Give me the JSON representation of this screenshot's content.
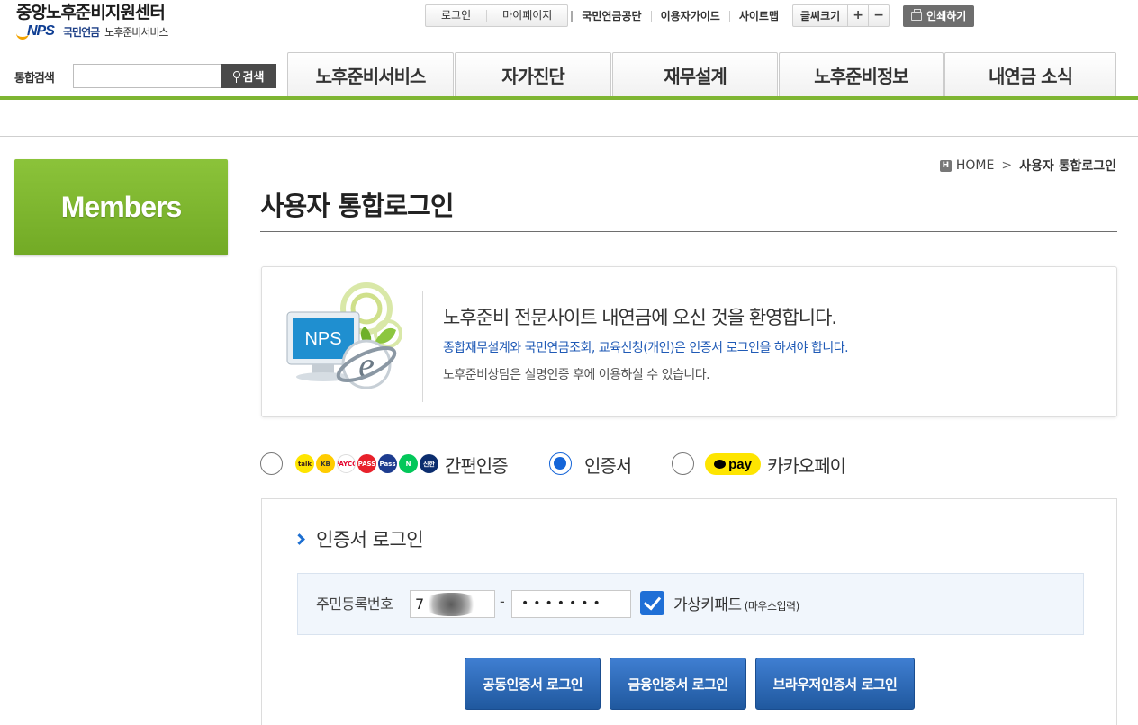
{
  "header": {
    "logo_title": "중앙노후준비지원센터",
    "logo_mark": "NPS",
    "logo_org": "국민연금",
    "logo_service": "노후준비서비스",
    "util_box": [
      "로그인",
      "마이페이지"
    ],
    "util_links": [
      "국민연금공단",
      "이용자가이드",
      "사이트맵"
    ],
    "font_size_label": "글씨크기",
    "font_plus": "+",
    "font_minus": "−",
    "print_label": "인쇄하기",
    "search_label": "통합검색",
    "search_value": "",
    "search_button": "검색"
  },
  "nav": {
    "tabs": [
      "노후준비서비스",
      "자가진단",
      "재무설계",
      "노후준비정보",
      "내연금 소식"
    ]
  },
  "sidebar": {
    "title": "Members"
  },
  "breadcrumb": {
    "home_badge": "H",
    "home": "HOME",
    "separator": ">",
    "current": "사용자 통합로그인"
  },
  "page": {
    "title": "사용자 통합로그인"
  },
  "welcome": {
    "image_text": "NPS",
    "line1": "노후준비 전문사이트 내연금에 오신 것을 환영합니다.",
    "line2": "종합재무설계와 국민연금조회, 교육신청(개인)은 인증서 로그인을 하셔야 합니다.",
    "line3": "노후준비상담은 실명인증 후에 이용하실 수 있습니다."
  },
  "auth_options": {
    "simple_label": "간편인증",
    "cert_label": "인증서",
    "kakaopay_label": "카카오페이",
    "pay_badge": "pay",
    "selected": "인증서",
    "provider_badges": [
      {
        "name": "kakaotalk-icon",
        "text": "talk",
        "bg": "#fee500",
        "fg": "#3a1d1d"
      },
      {
        "name": "kb-icon",
        "text": "KB",
        "bg": "#ffcc00",
        "fg": "#333"
      },
      {
        "name": "payco-icon",
        "text": "PAYCO",
        "bg": "#ffffff",
        "fg": "#e4002b"
      },
      {
        "name": "pass-icon",
        "text": "PASS",
        "bg": "#e8212b",
        "fg": "#ffffff"
      },
      {
        "name": "samsung-pass-icon",
        "text": "Pass",
        "bg": "#1d3c8f",
        "fg": "#ffffff"
      },
      {
        "name": "naver-icon",
        "text": "N",
        "bg": "#03c75a",
        "fg": "#ffffff"
      },
      {
        "name": "bank-icon",
        "text": "신한",
        "bg": "#0b2d6e",
        "fg": "#ffffff"
      }
    ]
  },
  "login": {
    "heading": "인증서 로그인",
    "jumin_label": "주민등록번호",
    "jumin_first": "7",
    "dash": "-",
    "jumin_second_masked": "•••••••",
    "virtual_keypad_checked": true,
    "virtual_keypad_label": "가상키패드",
    "virtual_keypad_note": "(마우스입력)",
    "buttons": [
      "공동인증서 로그인",
      "금융인증서 로그인",
      "브라우저인증서 로그인"
    ]
  },
  "colors": {
    "accent_green": "#7eb532",
    "accent_blue": "#1565d8",
    "button_blue": "#2a64ad"
  }
}
